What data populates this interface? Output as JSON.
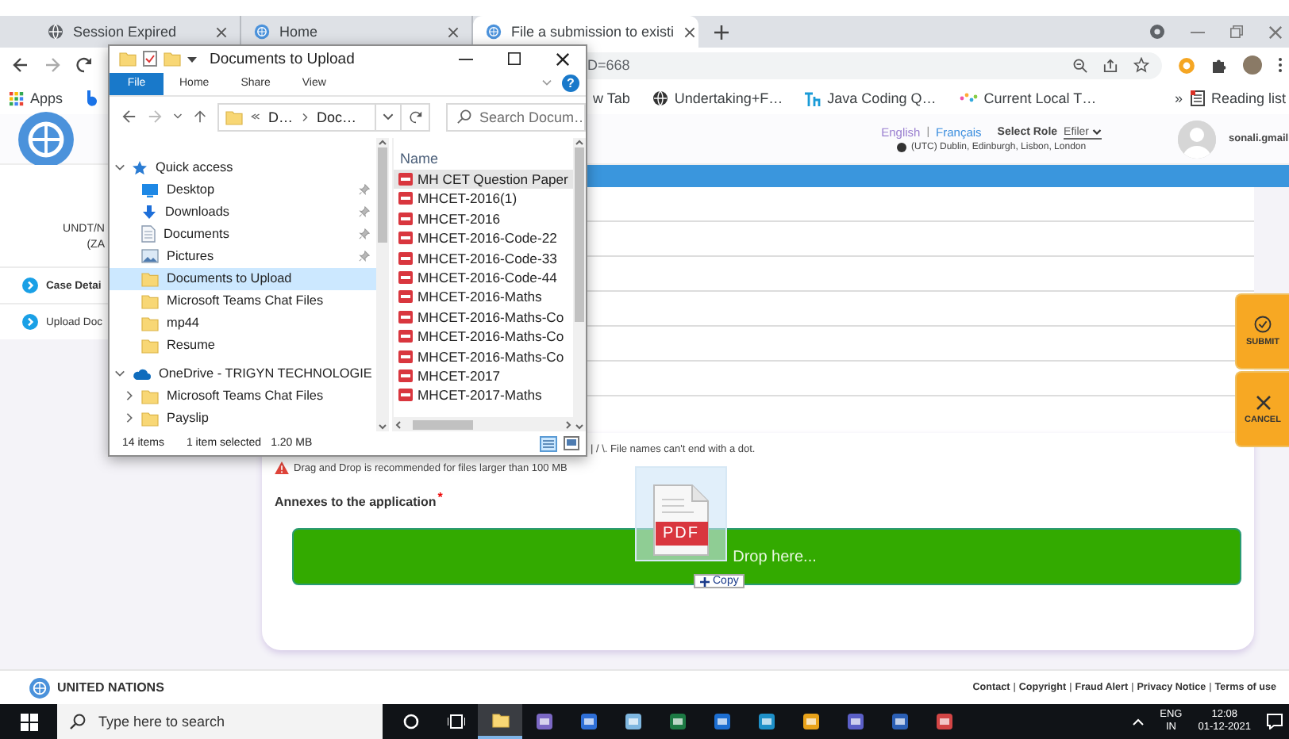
{
  "browser": {
    "tabs": [
      {
        "title": "Session Expired",
        "kind": "globe",
        "selected": false
      },
      {
        "title": "Home",
        "kind": "emblem",
        "selected": false
      },
      {
        "title": "File a submission to existi",
        "kind": "emblem",
        "selected": true
      }
    ],
    "address_fragment": "D=668",
    "apps": "Apps",
    "bookmarks": [
      {
        "label": "w Tab",
        "kind": "plain"
      },
      {
        "label": "Undertaking+F…",
        "kind": "globe"
      },
      {
        "label": "Java Coding Q…",
        "kind": "code"
      },
      {
        "label": "Current Local T…",
        "kind": "dots"
      }
    ],
    "more": "»",
    "reading_list": "Reading list"
  },
  "header": {
    "languages": [
      {
        "label": "English",
        "selected": true
      },
      {
        "label": "Français",
        "selected": false
      }
    ],
    "separator": "|",
    "role_label": "Select Role",
    "role_value": "Efiler",
    "timezone": "(UTC) Dublin, Edinburgh, Lisbon, London",
    "user": "sonali.gmail"
  },
  "sidebar": {
    "unit_lines": [
      "UNDT/N",
      "(ZA"
    ],
    "items": [
      "Case Detai",
      "Upload Doc"
    ]
  },
  "actions": [
    {
      "label": "SUBMIT",
      "kind": "submit"
    },
    {
      "label": "CANCEL",
      "kind": "cancel"
    }
  ],
  "upload": {
    "rule_fragment": "| / \\. File names can't end with a dot.",
    "warning": "Drag and Drop is recommended for files larger than 100 MB",
    "field_label": "Annexes to the application",
    "required_mark": "*",
    "drop_text": "Drop here...",
    "drag_badge": "PDF",
    "drag_effect": "Copy"
  },
  "explorer": {
    "title": "Documents to Upload",
    "ribbon_tabs": [
      {
        "label": "File",
        "kind": "menu"
      },
      {
        "label": "Home",
        "kind": "tab"
      },
      {
        "label": "Share",
        "kind": "tab"
      },
      {
        "label": "View",
        "kind": "tab"
      }
    ],
    "help": "?",
    "path": [
      "D…",
      "Doc…"
    ],
    "search_placeholder": "Search Docum…",
    "nav": [
      {
        "label": "Quick access",
        "kind": "star",
        "expanded": true,
        "selected": false,
        "children": [
          {
            "label": "Desktop",
            "kind": "desktop",
            "pinned": true,
            "selected": false
          },
          {
            "label": "Downloads",
            "kind": "download",
            "pinned": true,
            "selected": false
          },
          {
            "label": "Documents",
            "kind": "document",
            "pinned": true,
            "selected": false
          },
          {
            "label": "Pictures",
            "kind": "picture",
            "pinned": true,
            "selected": false
          },
          {
            "label": "Documents to Upload",
            "kind": "folder",
            "pinned": false,
            "selected": true
          },
          {
            "label": "Microsoft Teams Chat Files",
            "kind": "folder",
            "pinned": false,
            "selected": false
          },
          {
            "label": "mp44",
            "kind": "folder",
            "pinned": false,
            "selected": false
          },
          {
            "label": "Resume",
            "kind": "folder",
            "pinned": false,
            "selected": false
          }
        ]
      },
      {
        "label": "OneDrive - TRIGYN TECHNOLOGIE",
        "kind": "cloud",
        "expanded": true,
        "selected": false,
        "children": [
          {
            "label": "Microsoft Teams Chat Files",
            "kind": "folder",
            "expanded": false,
            "selected": false
          },
          {
            "label": "Payslip",
            "kind": "folder",
            "expanded": false,
            "selected": false
          }
        ]
      }
    ],
    "column": "Name",
    "files": [
      {
        "name": "MH CET Question Paper",
        "selected": true
      },
      {
        "name": "MHCET-2016(1)",
        "selected": false
      },
      {
        "name": "MHCET-2016",
        "selected": false
      },
      {
        "name": "MHCET-2016-Code-22",
        "selected": false
      },
      {
        "name": "MHCET-2016-Code-33",
        "selected": false
      },
      {
        "name": "MHCET-2016-Code-44",
        "selected": false
      },
      {
        "name": "MHCET-2016-Maths",
        "selected": false
      },
      {
        "name": "MHCET-2016-Maths-Co",
        "selected": false
      },
      {
        "name": "MHCET-2016-Maths-Co",
        "selected": false
      },
      {
        "name": "MHCET-2016-Maths-Co",
        "selected": false
      },
      {
        "name": "MHCET-2017",
        "selected": false
      },
      {
        "name": "MHCET-2017-Maths",
        "selected": false
      }
    ],
    "status": {
      "count": "14 items",
      "selection": "1 item selected",
      "size": "1.20 MB"
    }
  },
  "footer": {
    "org": "UNITED NATIONS",
    "links": [
      "Contact",
      "Copyright",
      "Fraud Alert",
      "Privacy Notice",
      "Terms of use"
    ],
    "separator": "|"
  },
  "taskbar": {
    "search_placeholder": "Type here to search",
    "language": "ENG",
    "region": "IN",
    "time": "12:08",
    "date": "01-12-2021"
  }
}
